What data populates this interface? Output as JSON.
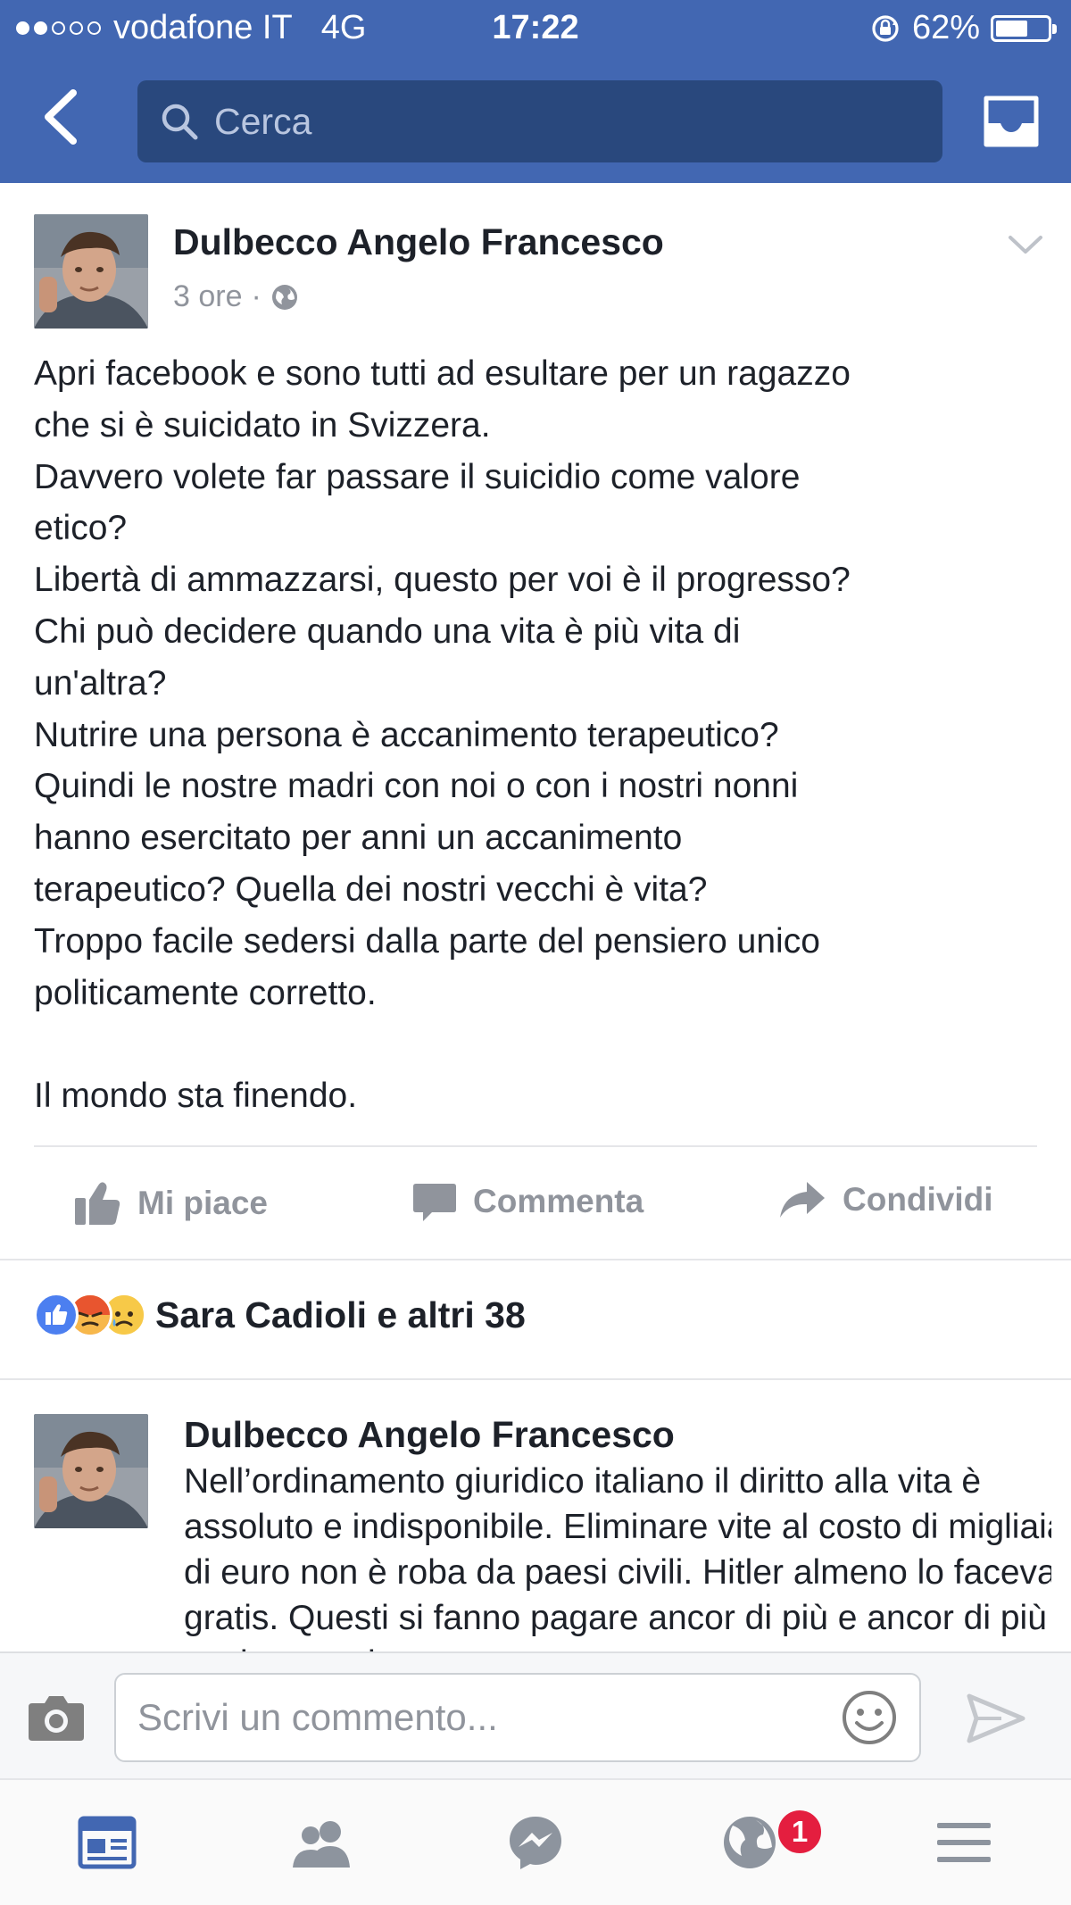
{
  "status_bar": {
    "carrier": "vodafone IT",
    "network": "4G",
    "time": "17:22",
    "battery": "62%",
    "battery_level": 0.62
  },
  "header": {
    "search_placeholder": "Cerca",
    "icons": [
      "back-arrow-icon",
      "search-icon",
      "inbox-icon"
    ]
  },
  "post": {
    "author": "Dulbecco Angelo Francesco",
    "time": "3 ore",
    "separator": "·",
    "privacy_icon": "globe-icon",
    "body": "Apri facebook e sono tutti ad esultare per un ragazzo\nche si è suicidato in Svizzera.\nDavvero volete far passare il suicidio come valore\netico?\nLibertà di ammazzarsi, questo per voi è il progresso?\nChi può decidere quando una vita è più vita di\nun'altra?\nNutrire una persona è accanimento terapeutico?\nQuindi le nostre madri con noi o con i nostri nonni\nhanno esercitato per anni un accanimento\nterapeutico? Quella dei nostri vecchi è vita?\nTroppo facile sedersi dalla parte del pensiero unico\npoliticamente corretto.",
    "closing": "Il mondo sta finendo."
  },
  "actions": {
    "like": "Mi piace",
    "comment": "Commenta",
    "share": "Condividi"
  },
  "reactions": {
    "types": [
      "like",
      "angry",
      "sad"
    ],
    "label": "Sara Cadioli e altri 38"
  },
  "comment": {
    "author": "Dulbecco Angelo Francesco",
    "text": "Nell’ordinamento giuridico italiano il diritto alla vita è assoluto e indisponibile. Eliminare vite al costo di migliaia di euro non è roba da paesi civili. Hitler almeno lo faceva gratis. Questi si fanno pagare ancor di più e ancor di più anche per altro."
  },
  "composer": {
    "placeholder": "Scrivi un commento..."
  },
  "tabbar": {
    "tabs": [
      "news-feed-icon",
      "friends-icon",
      "messenger-icon",
      "notifications-globe-icon",
      "menu-icon"
    ],
    "notification_count": "1"
  },
  "colors": {
    "brand": "#4267b2",
    "search_bg": "#29487d",
    "secondary_text": "#90949c",
    "badge": "#e41e3f"
  }
}
